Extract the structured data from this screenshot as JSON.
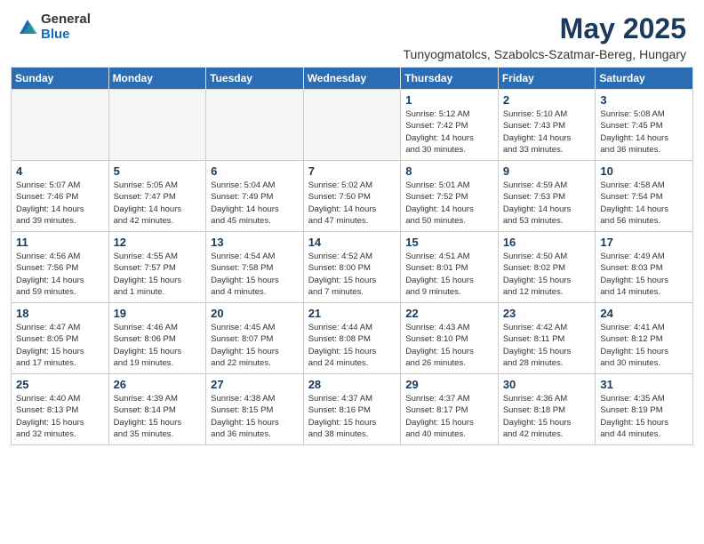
{
  "header": {
    "logo_general": "General",
    "logo_blue": "Blue",
    "month": "May 2025",
    "location": "Tunyogmatolcs, Szabolcs-Szatmar-Bereg, Hungary"
  },
  "columns": [
    "Sunday",
    "Monday",
    "Tuesday",
    "Wednesday",
    "Thursday",
    "Friday",
    "Saturday"
  ],
  "weeks": [
    [
      {
        "day": "",
        "info": ""
      },
      {
        "day": "",
        "info": ""
      },
      {
        "day": "",
        "info": ""
      },
      {
        "day": "",
        "info": ""
      },
      {
        "day": "1",
        "info": "Sunrise: 5:12 AM\nSunset: 7:42 PM\nDaylight: 14 hours\nand 30 minutes."
      },
      {
        "day": "2",
        "info": "Sunrise: 5:10 AM\nSunset: 7:43 PM\nDaylight: 14 hours\nand 33 minutes."
      },
      {
        "day": "3",
        "info": "Sunrise: 5:08 AM\nSunset: 7:45 PM\nDaylight: 14 hours\nand 36 minutes."
      }
    ],
    [
      {
        "day": "4",
        "info": "Sunrise: 5:07 AM\nSunset: 7:46 PM\nDaylight: 14 hours\nand 39 minutes."
      },
      {
        "day": "5",
        "info": "Sunrise: 5:05 AM\nSunset: 7:47 PM\nDaylight: 14 hours\nand 42 minutes."
      },
      {
        "day": "6",
        "info": "Sunrise: 5:04 AM\nSunset: 7:49 PM\nDaylight: 14 hours\nand 45 minutes."
      },
      {
        "day": "7",
        "info": "Sunrise: 5:02 AM\nSunset: 7:50 PM\nDaylight: 14 hours\nand 47 minutes."
      },
      {
        "day": "8",
        "info": "Sunrise: 5:01 AM\nSunset: 7:52 PM\nDaylight: 14 hours\nand 50 minutes."
      },
      {
        "day": "9",
        "info": "Sunrise: 4:59 AM\nSunset: 7:53 PM\nDaylight: 14 hours\nand 53 minutes."
      },
      {
        "day": "10",
        "info": "Sunrise: 4:58 AM\nSunset: 7:54 PM\nDaylight: 14 hours\nand 56 minutes."
      }
    ],
    [
      {
        "day": "11",
        "info": "Sunrise: 4:56 AM\nSunset: 7:56 PM\nDaylight: 14 hours\nand 59 minutes."
      },
      {
        "day": "12",
        "info": "Sunrise: 4:55 AM\nSunset: 7:57 PM\nDaylight: 15 hours\nand 1 minute."
      },
      {
        "day": "13",
        "info": "Sunrise: 4:54 AM\nSunset: 7:58 PM\nDaylight: 15 hours\nand 4 minutes."
      },
      {
        "day": "14",
        "info": "Sunrise: 4:52 AM\nSunset: 8:00 PM\nDaylight: 15 hours\nand 7 minutes."
      },
      {
        "day": "15",
        "info": "Sunrise: 4:51 AM\nSunset: 8:01 PM\nDaylight: 15 hours\nand 9 minutes."
      },
      {
        "day": "16",
        "info": "Sunrise: 4:50 AM\nSunset: 8:02 PM\nDaylight: 15 hours\nand 12 minutes."
      },
      {
        "day": "17",
        "info": "Sunrise: 4:49 AM\nSunset: 8:03 PM\nDaylight: 15 hours\nand 14 minutes."
      }
    ],
    [
      {
        "day": "18",
        "info": "Sunrise: 4:47 AM\nSunset: 8:05 PM\nDaylight: 15 hours\nand 17 minutes."
      },
      {
        "day": "19",
        "info": "Sunrise: 4:46 AM\nSunset: 8:06 PM\nDaylight: 15 hours\nand 19 minutes."
      },
      {
        "day": "20",
        "info": "Sunrise: 4:45 AM\nSunset: 8:07 PM\nDaylight: 15 hours\nand 22 minutes."
      },
      {
        "day": "21",
        "info": "Sunrise: 4:44 AM\nSunset: 8:08 PM\nDaylight: 15 hours\nand 24 minutes."
      },
      {
        "day": "22",
        "info": "Sunrise: 4:43 AM\nSunset: 8:10 PM\nDaylight: 15 hours\nand 26 minutes."
      },
      {
        "day": "23",
        "info": "Sunrise: 4:42 AM\nSunset: 8:11 PM\nDaylight: 15 hours\nand 28 minutes."
      },
      {
        "day": "24",
        "info": "Sunrise: 4:41 AM\nSunset: 8:12 PM\nDaylight: 15 hours\nand 30 minutes."
      }
    ],
    [
      {
        "day": "25",
        "info": "Sunrise: 4:40 AM\nSunset: 8:13 PM\nDaylight: 15 hours\nand 32 minutes."
      },
      {
        "day": "26",
        "info": "Sunrise: 4:39 AM\nSunset: 8:14 PM\nDaylight: 15 hours\nand 35 minutes."
      },
      {
        "day": "27",
        "info": "Sunrise: 4:38 AM\nSunset: 8:15 PM\nDaylight: 15 hours\nand 36 minutes."
      },
      {
        "day": "28",
        "info": "Sunrise: 4:37 AM\nSunset: 8:16 PM\nDaylight: 15 hours\nand 38 minutes."
      },
      {
        "day": "29",
        "info": "Sunrise: 4:37 AM\nSunset: 8:17 PM\nDaylight: 15 hours\nand 40 minutes."
      },
      {
        "day": "30",
        "info": "Sunrise: 4:36 AM\nSunset: 8:18 PM\nDaylight: 15 hours\nand 42 minutes."
      },
      {
        "day": "31",
        "info": "Sunrise: 4:35 AM\nSunset: 8:19 PM\nDaylight: 15 hours\nand 44 minutes."
      }
    ]
  ]
}
